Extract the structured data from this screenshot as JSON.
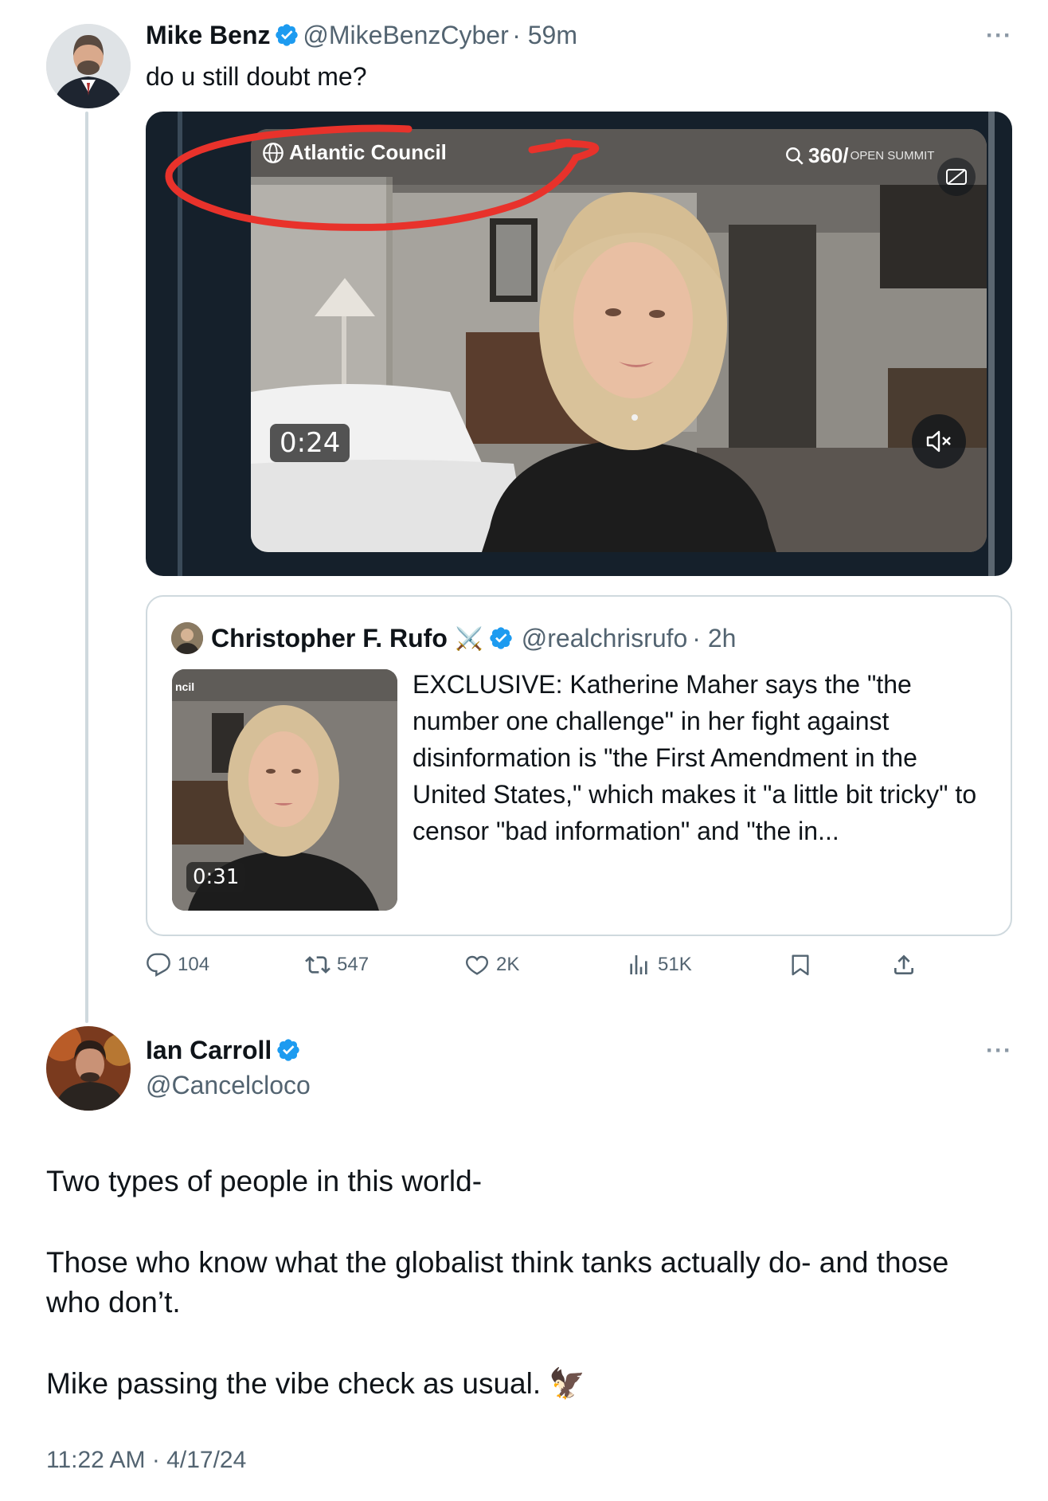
{
  "tweet1": {
    "author_name": "Mike Benz",
    "handle": "@MikeBenzCyber",
    "time": "· 59m",
    "text": "do u still doubt me?",
    "more_label": "···",
    "video": {
      "overlay_org": "Atlantic Council",
      "overlay_brand": "360/",
      "overlay_brand_small": "OPEN SUMMIT",
      "duration": "0:24"
    },
    "quote": {
      "author_name": "Christopher F. Rufo",
      "name_emoji": "⚔️",
      "handle": "@realchrisrufo",
      "time": "· 2h",
      "text": "EXCLUSIVE: Katherine Maher says the \"the number one challenge\" in her fight against disinformation is \"the First Amendment in the United States,\" which makes it \"a little bit tricky\" to censor \"bad information\" and \"the in...",
      "thumb_duration": "0:31",
      "thumb_overlay": "ncil"
    },
    "stats": {
      "replies": "104",
      "retweets": "547",
      "likes": "2K",
      "views": "51K"
    }
  },
  "tweet2": {
    "author_name": "Ian Carroll",
    "handle": "@Cancelcloco",
    "more_label": "···",
    "paragraphs": [
      "Two types of people in this world-",
      "Those who know what the globalist think tanks actually do- and those who don’t.",
      "Mike passing the vibe check as usual. 🦅"
    ],
    "timestamp": "11:22 AM · 4/17/24"
  },
  "colors": {
    "verified_blue": "#1d9bf0",
    "secondary_text": "#536471",
    "border": "#cfd9de",
    "annotation_red": "#e8322b"
  }
}
